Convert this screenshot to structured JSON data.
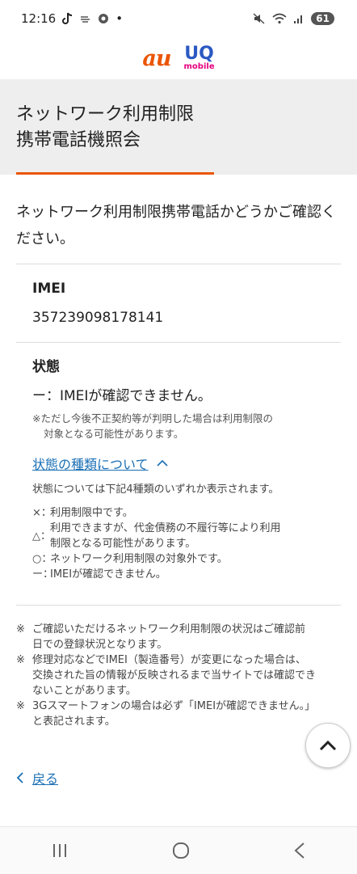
{
  "status_bar": {
    "time": "12:16",
    "dot": "•",
    "battery": "61"
  },
  "logos": {
    "au": "au",
    "uq": "UQ",
    "uq_sub": "mobile"
  },
  "page": {
    "title_line1": "ネットワーク利用制限",
    "title_line2": "携帯電話機照会",
    "intro": "ネットワーク利用制限携帯電話かどうかご確認ください。"
  },
  "imei": {
    "label": "IMEI",
    "value": "357239098178141"
  },
  "status": {
    "label": "状態",
    "value": "ー：IMEIが確認できません。",
    "note_line1": "※ただし今後不正契約等が判明した場合は利用制限の",
    "note_line2": "対象となる可能性があります。"
  },
  "status_types": {
    "toggle_label": "状態の種類について",
    "intro": "状態については下記4種類のいずれか表示されます。",
    "items": [
      {
        "symbol": "×：",
        "text": "利用制限中です。"
      },
      {
        "symbol": "△：",
        "text_line1": "利用できますが、代金債務の不履行等により利用",
        "text_line2": "制限となる可能性があります。"
      },
      {
        "symbol": "○：",
        "text": "ネットワーク利用制限の対象外です。"
      },
      {
        "symbol": "ー：",
        "text": "IMEIが確認できません。"
      }
    ]
  },
  "footnotes": [
    {
      "mark": "※",
      "line1": "ご確認いただけるネットワーク利用制限の状況はご確認前",
      "line2": "日での登録状況となります。"
    },
    {
      "mark": "※",
      "line1": "修理対応などでIMEI（製造番号）が変更になった場合は、",
      "line2": "交換された旨の情報が反映されるまで当サイトでは確認でき",
      "line3": "ないことがあります。"
    },
    {
      "mark": "※",
      "line1": "3Gスマートフォンの場合は必ず「IMEIが確認できません。」",
      "line2": "と表記されます。"
    }
  ],
  "back": {
    "label": "戻る"
  },
  "colors": {
    "accent": "#eb5505",
    "link": "#1a6fb5",
    "uq_blue": "#2b59c3",
    "uq_pink": "#e5007e"
  },
  "icons": [
    "tiktok-icon",
    "wind-icon",
    "chrome-icon",
    "mute-icon",
    "wifi-icon",
    "signal-icon",
    "chevron-up-icon",
    "chevron-left-icon",
    "scroll-top-icon",
    "recents-icon",
    "home-icon",
    "back-nav-icon"
  ]
}
